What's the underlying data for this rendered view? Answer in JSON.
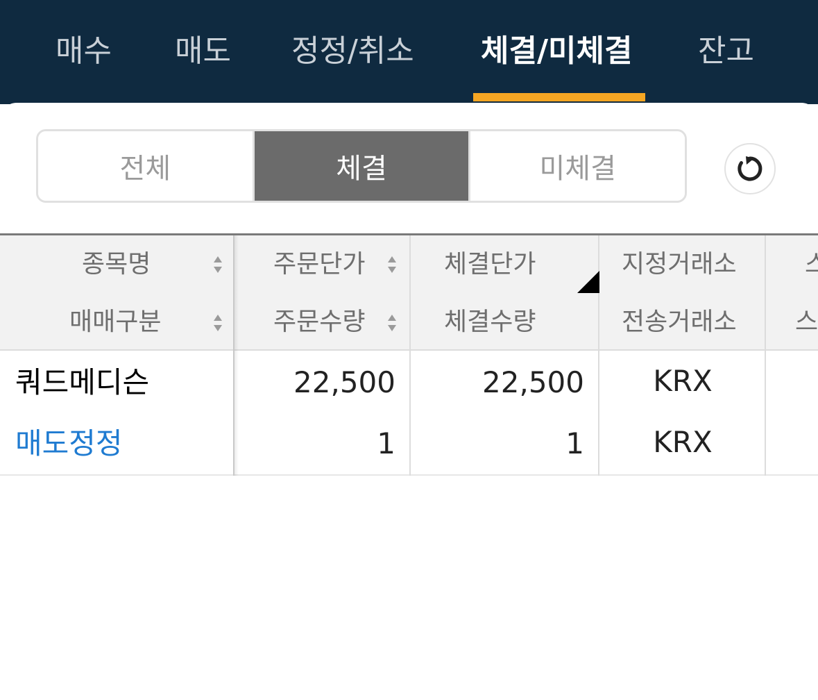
{
  "tabs": [
    {
      "label": "매수",
      "active": false
    },
    {
      "label": "매도",
      "active": false
    },
    {
      "label": "정정/취소",
      "active": false
    },
    {
      "label": "체결/미체결",
      "active": true
    },
    {
      "label": "잔고",
      "active": false
    }
  ],
  "filter": {
    "options": [
      "전체",
      "체결",
      "미체결"
    ],
    "selected": "체결"
  },
  "refresh_icon": "refresh-icon",
  "table": {
    "headers_top": [
      "종목명",
      "주문단가",
      "체결단가",
      "지정거래소",
      "스"
    ],
    "headers_bottom": [
      "매매구분",
      "주문수량",
      "체결수량",
      "전송거래소",
      "스"
    ],
    "rows": [
      {
        "name": "쿼드메디슨",
        "side": "매도정정",
        "order_price": "22,500",
        "filled_price": "22,500",
        "order_qty": "1",
        "filled_qty": "1",
        "designated_exchange": "KRX",
        "sent_exchange": "KRX"
      }
    ]
  },
  "colors": {
    "nav_bg": "#0f2a40",
    "active_underline": "#f5a623",
    "segment_active": "#6b6b6b",
    "sell_text": "#1f7bd1"
  }
}
